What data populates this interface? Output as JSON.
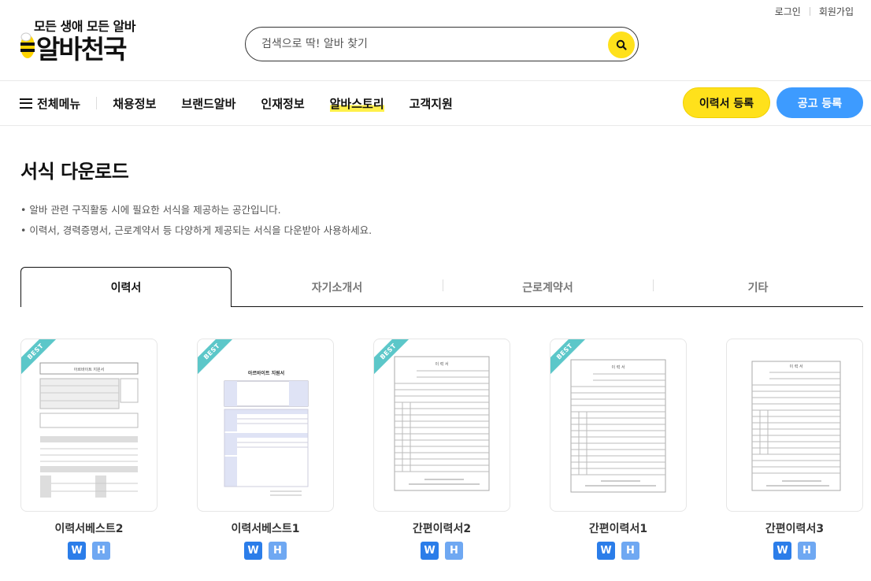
{
  "util": {
    "login": "로그인",
    "signup": "회원가입"
  },
  "logo": {
    "slogan": "모든 생애 모든 알바",
    "name": "알바천국"
  },
  "search": {
    "placeholder": "검색으로 딱! 알바 찾기"
  },
  "nav": {
    "all_menu": "전체메뉴",
    "items": [
      "채용정보",
      "브랜드알바",
      "인재정보",
      "알바스토리",
      "고객지원"
    ],
    "resume_button": "이력서 등록",
    "post_button": "공고 등록"
  },
  "page": {
    "title": "서식 다운로드",
    "desc": [
      "• 알바 관련 구직활동 시에 필요한 서식을 제공하는 공간입니다.",
      "• 이력서, 경력증명서, 근로계약서 등 다양하게 제공되는 서식을 다운받아 사용하세요."
    ]
  },
  "tabs": [
    "이력서",
    "자기소개서",
    "근로계약서",
    "기타"
  ],
  "cards": [
    {
      "title": "이력서베스트2",
      "badge": "BEST",
      "w": "W",
      "h": "H",
      "doc_heading": "아르바이트 지원서"
    },
    {
      "title": "이력서베스트1",
      "badge": "BEST",
      "w": "W",
      "h": "H",
      "doc_heading": "아르바이트 지원서"
    },
    {
      "title": "간편이력서2",
      "badge": "BEST",
      "w": "W",
      "h": "H",
      "doc_heading": "이 력 서"
    },
    {
      "title": "간편이력서1",
      "badge": "BEST",
      "w": "W",
      "h": "H",
      "doc_heading": "이 력 서"
    },
    {
      "title": "간편이력서3",
      "badge": "",
      "w": "W",
      "h": "H",
      "doc_heading": "이 력 서"
    }
  ],
  "colors": {
    "accent_yellow": "#ffe11b",
    "accent_blue": "#3d9bff",
    "best_badge": "#5cc7c9"
  }
}
